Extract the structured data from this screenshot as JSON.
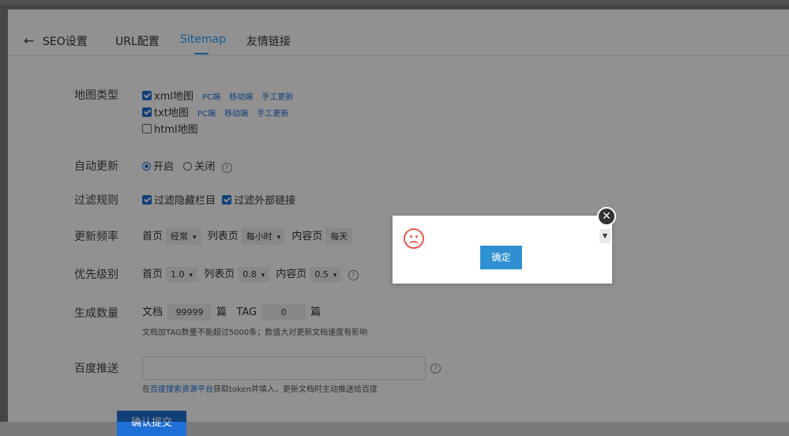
{
  "header": {
    "back_icon": "←",
    "tabs": [
      {
        "label": "SEO设置"
      },
      {
        "label": "URL配置"
      },
      {
        "label": "Sitemap"
      },
      {
        "label": "友情链接"
      }
    ],
    "active_color": "#1e9fff"
  },
  "form": {
    "map_type": {
      "label": "地图类型",
      "options": [
        {
          "name": "xml地图",
          "checked": true,
          "links": [
            "PC端",
            "移动端",
            "手工更新"
          ]
        },
        {
          "name": "txt地图",
          "checked": true,
          "links": [
            "PC端",
            "移动端",
            "手工更新"
          ]
        },
        {
          "name": "html地图",
          "checked": false,
          "links": []
        }
      ]
    },
    "auto_update": {
      "label": "自动更新",
      "on": "开启",
      "off": "关闭",
      "selected": "开启"
    },
    "filter": {
      "label": "过滤规则",
      "options": [
        {
          "name": "过滤隐藏栏目",
          "checked": true
        },
        {
          "name": "过滤外部链接",
          "checked": true
        }
      ]
    },
    "frequency": {
      "label": "更新频率",
      "home_label": "首页",
      "home_value": "经常",
      "list_label": "列表页",
      "list_value": "每小时",
      "content_label": "内容页",
      "content_value": "每天"
    },
    "priority": {
      "label": "优先级别",
      "home_label": "首页",
      "home_value": "1.0",
      "list_label": "列表页",
      "list_value": "0.8",
      "content_label": "内容页",
      "content_value": "0.5"
    },
    "count": {
      "label": "生成数量",
      "doc_label": "文档",
      "doc_value": "99999",
      "doc_unit": "篇",
      "tag_label": "TAG",
      "tag_value": "0",
      "tag_unit": "篇",
      "hint": "文档加TAG数量不能超过5000条；数值大对更新文档速度有影响"
    },
    "baidu": {
      "label": "百度推送",
      "value": "",
      "hint_prefix": "在",
      "hint_link": "百度搜索资源平台",
      "hint_suffix": "获取token并填入，更新文档时主动推送给百度"
    },
    "submit_label": "确认提交"
  },
  "dialog": {
    "icon": "sad-face-icon",
    "ok_label": "确定",
    "close_icon": "close-icon"
  }
}
